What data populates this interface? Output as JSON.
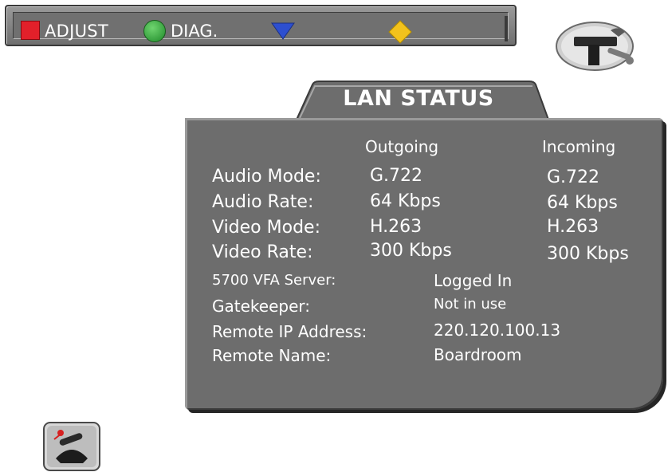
{
  "toolbar": {
    "adjust_label": "ADJUST",
    "diag_label": "DIAG.",
    "colors": {
      "red": "#e2202a",
      "green": "#2fa83a",
      "blue": "#2d4fd0",
      "yellow": "#f2c21c"
    },
    "icons": [
      "red-square-icon",
      "green-circle-icon",
      "blue-triangle-down-icon",
      "yellow-diamond-icon"
    ]
  },
  "header_icons": {
    "tools": "tools-wrench-icon"
  },
  "lan_status": {
    "title": "LAN STATUS",
    "columns": {
      "outgoing": "Outgoing",
      "incoming": "Incoming"
    },
    "rows": [
      {
        "label": "Audio Mode:",
        "outgoing": "G.722",
        "incoming": "G.722"
      },
      {
        "label": "Audio Rate:",
        "outgoing": "64 Kbps",
        "incoming": "64 Kbps"
      },
      {
        "label": "Video Mode:",
        "outgoing": "H.263",
        "incoming": "H.263"
      },
      {
        "label": "Video Rate:",
        "outgoing": "300 Kbps",
        "incoming": "300 Kbps"
      }
    ],
    "details": [
      {
        "label": "5700 VFA Server:",
        "value": "Logged In"
      },
      {
        "label": "Gatekeeper:",
        "value": "Not in use"
      },
      {
        "label": "Remote IP Address:",
        "value": "220.120.100.13"
      },
      {
        "label": "Remote Name:",
        "value": "Boardroom"
      }
    ]
  },
  "footer_icons": {
    "phone": "hang-up-phone-icon"
  }
}
